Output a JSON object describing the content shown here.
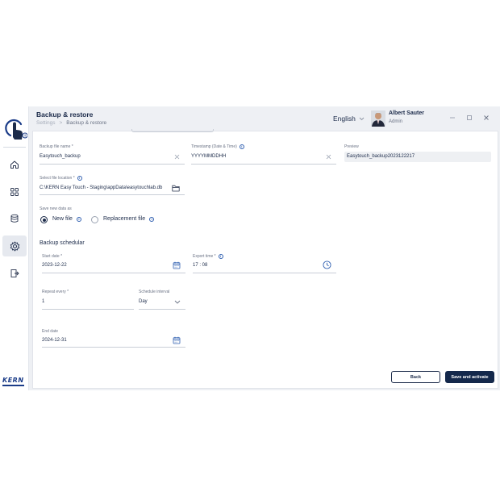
{
  "header": {
    "title": "Backup & restore",
    "breadcrumb": {
      "root": "Settings",
      "separator": ">",
      "current": "Backup & restore"
    },
    "language": "English",
    "user": {
      "name": "Albert Sauter",
      "role": "Admin"
    }
  },
  "sidebar": {
    "items": [
      {
        "name": "home",
        "icon": "home-icon"
      },
      {
        "name": "apps",
        "icon": "grid-icon"
      },
      {
        "name": "database",
        "icon": "database-icon"
      },
      {
        "name": "settings",
        "icon": "gear-icon",
        "active": true
      },
      {
        "name": "logout",
        "icon": "logout-icon"
      }
    ],
    "brand": "KERN"
  },
  "form": {
    "backup_file_name": {
      "label": "Backup file name *",
      "value": "Easytouch_backup"
    },
    "timestamp": {
      "label": "Timestamp (Date & Time)",
      "value": "YYYYMMDDHH"
    },
    "preview": {
      "label": "Preview",
      "value": "Easytouch_backup2023122217"
    },
    "file_location": {
      "label": "Select file location *",
      "value": "C:\\KERN Easy Touch - Staging\\appData\\easytouchlab.db"
    },
    "save_new_data": {
      "label": "Save new data as",
      "options": [
        {
          "label": "New file",
          "selected": true
        },
        {
          "label": "Replacement file",
          "selected": false
        }
      ]
    }
  },
  "schedular": {
    "title": "Backup schedular",
    "start_date": {
      "label": "Start date *",
      "value": "2023-12-22"
    },
    "export_time": {
      "label": "Export time *",
      "value": "17 : 08"
    },
    "repeat_every": {
      "label": "Repeat every *",
      "value": "1"
    },
    "schedule_interval": {
      "label": "Schedule interval",
      "value": "Day"
    },
    "end_date": {
      "label": "End date",
      "value": "2024-12-31"
    }
  },
  "actions": {
    "back": "Back",
    "save": "Save and activate"
  },
  "colors": {
    "primary": "#14284b",
    "accent": "#2f5fb0",
    "page_bg": "#eef0f4"
  }
}
